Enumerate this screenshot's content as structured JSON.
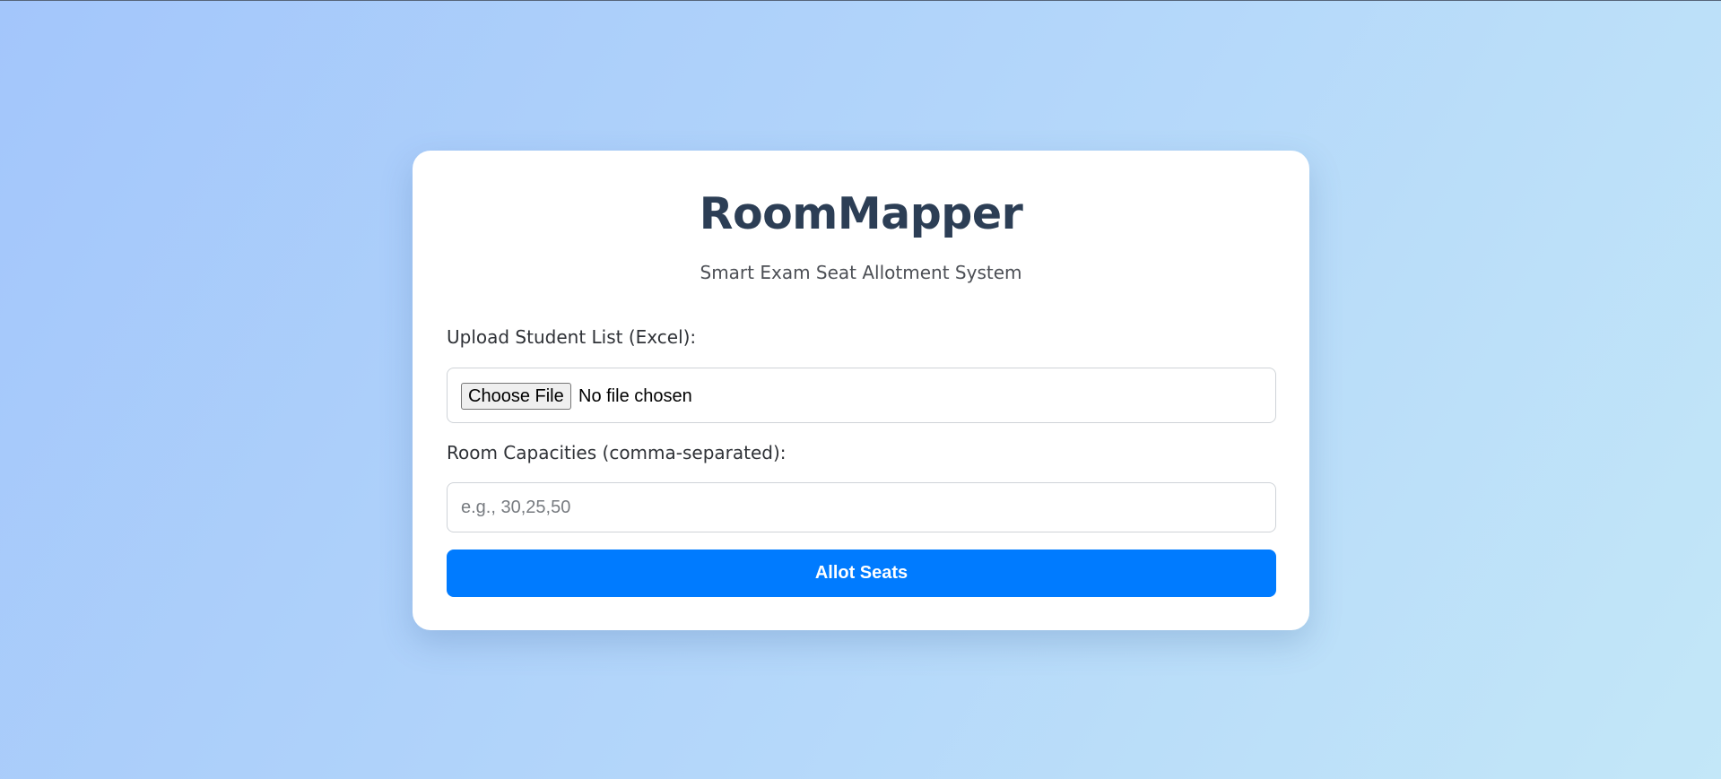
{
  "app": {
    "title": "RoomMapper",
    "subtitle": "Smart Exam Seat Allotment System"
  },
  "form": {
    "upload_label": "Upload Student List (Excel):",
    "file_button_label": "Choose File",
    "file_status": "No file chosen",
    "capacities_label": "Room Capacities (comma-separated):",
    "capacities_value": "",
    "capacities_placeholder": "e.g., 30,25,50",
    "submit_label": "Allot Seats"
  },
  "colors": {
    "accent": "#007bff",
    "title": "#2c3e55",
    "background_start": "#a3c6fb",
    "background_end": "#c3e7f8"
  }
}
